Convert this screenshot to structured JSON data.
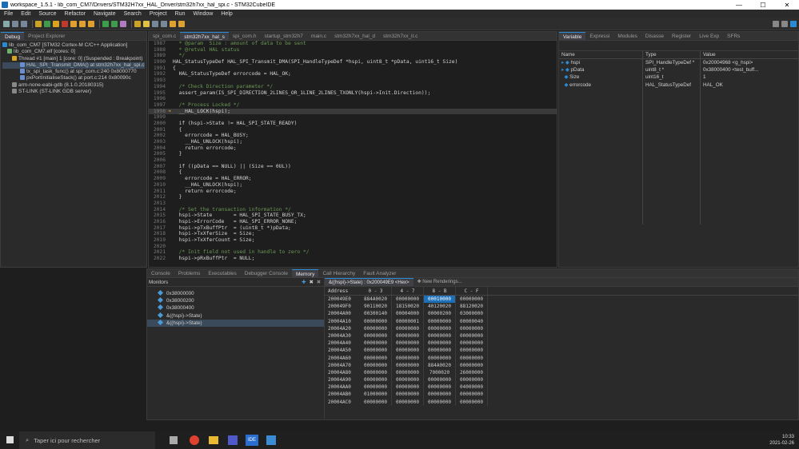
{
  "window": {
    "title": "workspace_1.5.1 - lib_com_CM7/Drivers/STM32H7xx_HAL_Driver/stm32h7xx_hal_spi.c - STM32CubeIDE",
    "minimize": "—",
    "maximize": "☐",
    "close": "✕"
  },
  "menu": [
    "File",
    "Edit",
    "Source",
    "Refactor",
    "Navigate",
    "Search",
    "Project",
    "Run",
    "Window",
    "Help"
  ],
  "debug_panel": {
    "tabs": [
      "Debug",
      "Project Explorer"
    ],
    "tree": [
      "lib_com_CM7 [STM32 Cortex-M C/C++ Application]",
      "lib_com_CM7.elf [cores: 0]",
      "Thread #1 [main] 1 [core: 0] (Suspended : Breakpoint)",
      "HAL_SPI_Transmit_DMA() at stm32h7xx_hal_spi.c",
      "tx_spi_task_func() at spi_com.c:240 0x8000770",
      "pxPortInitialiseStack() at port.c:214 0x80090c",
      "arm-none-eabi-gdb (8.1.0.20180315)",
      "ST-LINK (ST-LINK GDB server)"
    ]
  },
  "editor": {
    "tabs": [
      "spi_com.c",
      "stm32h7xx_hal_s",
      "spi_com.h",
      "startup_stm32h7",
      "main.c",
      "stm32h7xx_hal_d",
      "stm32h7xx_it.c"
    ],
    "lines": [
      {
        "n": "1987",
        "t": "  * @param  Size : amount of data to be sent"
      },
      {
        "n": "1988",
        "t": "  * @retval HAL status"
      },
      {
        "n": "1989",
        "t": "  */"
      },
      {
        "n": "1990",
        "t": "HAL_StatusTypeDef HAL_SPI_Transmit_DMA(SPI_HandleTypeDef *hspi, uint8_t *pData, uint16_t Size)"
      },
      {
        "n": "1991",
        "t": "{"
      },
      {
        "n": "1992",
        "t": "  HAL_StatusTypeDef errorcode = HAL_OK;"
      },
      {
        "n": "1993",
        "t": ""
      },
      {
        "n": "1994",
        "t": "  /* Check Direction parameter */"
      },
      {
        "n": "1995",
        "t": "  assert_param(IS_SPI_DIRECTION_2LINES_OR_1LINE_2LINES_TXONLY(hspi->Init.Direction));"
      },
      {
        "n": "1996",
        "t": ""
      },
      {
        "n": "1997",
        "t": "  /* Process Locked */"
      },
      {
        "n": "1998",
        "t": "  __HAL_LOCK(hspi);"
      },
      {
        "n": "1999",
        "t": ""
      },
      {
        "n": "2000",
        "t": "  if (hspi->State != HAL_SPI_STATE_READY)"
      },
      {
        "n": "2001",
        "t": "  {"
      },
      {
        "n": "2002",
        "t": "    errorcode = HAL_BUSY;"
      },
      {
        "n": "2003",
        "t": "    __HAL_UNLOCK(hspi);"
      },
      {
        "n": "2004",
        "t": "    return errorcode;"
      },
      {
        "n": "2005",
        "t": "  }"
      },
      {
        "n": "2006",
        "t": ""
      },
      {
        "n": "2007",
        "t": "  if ((pData == NULL) || (Size == 0UL))"
      },
      {
        "n": "2008",
        "t": "  {"
      },
      {
        "n": "2009",
        "t": "    errorcode = HAL_ERROR;"
      },
      {
        "n": "2010",
        "t": "    __HAL_UNLOCK(hspi);"
      },
      {
        "n": "2011",
        "t": "    return errorcode;"
      },
      {
        "n": "2012",
        "t": "  }"
      },
      {
        "n": "2013",
        "t": ""
      },
      {
        "n": "2014",
        "t": "  /* Set the transaction information */"
      },
      {
        "n": "2015",
        "t": "  hspi->State       = HAL_SPI_STATE_BUSY_TX;"
      },
      {
        "n": "2016",
        "t": "  hspi->ErrorCode   = HAL_SPI_ERROR_NONE;"
      },
      {
        "n": "2017",
        "t": "  hspi->pTxBuffPtr  = (uint8_t *)pData;"
      },
      {
        "n": "2018",
        "t": "  hspi->TxXferSize  = Size;"
      },
      {
        "n": "2019",
        "t": "  hspi->TxXferCount = Size;"
      },
      {
        "n": "2020",
        "t": ""
      },
      {
        "n": "2021",
        "t": "  /* Init field not used in handle to zero */"
      },
      {
        "n": "2022",
        "t": "  hspi->pRxBuffPtr  = NULL;"
      }
    ]
  },
  "variables": {
    "tabs": [
      "Variable",
      "Expressi",
      "Modules",
      "Disasse",
      "Register",
      "Live Exp",
      "SFRs"
    ],
    "headers": [
      "Name",
      "Type",
      "Value"
    ],
    "rows": [
      {
        "name": "hspi",
        "type": "SPI_HandleTypeDef *",
        "value": "0x20004968 <g_hspi>"
      },
      {
        "name": "pData",
        "type": "uint8_t *",
        "value": "0x38000400 <test_buff..."
      },
      {
        "name": "Size",
        "type": "uint16_t",
        "value": "1"
      },
      {
        "name": "errorcode",
        "type": "HAL_StatusTypeDef",
        "value": "HAL_OK"
      }
    ]
  },
  "bottom": {
    "tabs": [
      "Console",
      "Problems",
      "Executables",
      "Debugger Console",
      "Memory",
      "Call Hierarchy",
      "Fault Analyzer"
    ],
    "monitors_label": "Monitors",
    "monitors": [
      "0x38000000",
      "0x38000200",
      "0x38000400",
      "&((hspi)->State)",
      "&((hspi)->State)"
    ],
    "rendering_tab": "&((hspi)->State) : 0x200049E9 <Hex>",
    "new_renderings": "New Renderings...",
    "mem_headers": [
      "Address",
      "0 - 3",
      "4 - 7",
      "8 - B",
      "C - F"
    ],
    "mem_rows": [
      [
        "200049E0",
        "884A0020",
        "00000000",
        "00010000",
        "00000000"
      ],
      [
        "200049F0",
        "90110020",
        "18150020",
        "40120020",
        "88120020"
      ],
      [
        "20004A00",
        "00300140",
        "00004000",
        "00000200",
        "03000000"
      ],
      [
        "20004A10",
        "00000000",
        "00000001",
        "00000000",
        "00000040"
      ],
      [
        "20004A20",
        "00000000",
        "00000000",
        "00000000",
        "00000000"
      ],
      [
        "20004A30",
        "00000000",
        "00000000",
        "00000000",
        "00000000"
      ],
      [
        "20004A40",
        "00000000",
        "00000000",
        "00000000",
        "00000000"
      ],
      [
        "20004A50",
        "00000000",
        "00000000",
        "00000000",
        "00000000"
      ],
      [
        "20004A60",
        "00000000",
        "00000000",
        "00000000",
        "00000000"
      ],
      [
        "20004A70",
        "00000000",
        "00000000",
        "884A0020",
        "00000000"
      ],
      [
        "20004A80",
        "00000000",
        "00000000",
        "7000020",
        "26000000"
      ],
      [
        "20004A90",
        "00000000",
        "00000000",
        "00000000",
        "00000000"
      ],
      [
        "20004AA0",
        "00000000",
        "00000000",
        "00000000",
        "04000000"
      ],
      [
        "20004AB0",
        "01000000",
        "00000000",
        "00000000",
        "00000000"
      ],
      [
        "20004AC0",
        "00000000",
        "00000000",
        "00000000",
        "00000000"
      ]
    ]
  },
  "taskbar": {
    "search_placeholder": "Taper ici pour rechercher",
    "time": "10:33",
    "date": "2021-02-26"
  },
  "colors": {
    "accent": "#2a8ad4",
    "highlight": "#1d6fb8",
    "keyword": "#cc7832"
  }
}
